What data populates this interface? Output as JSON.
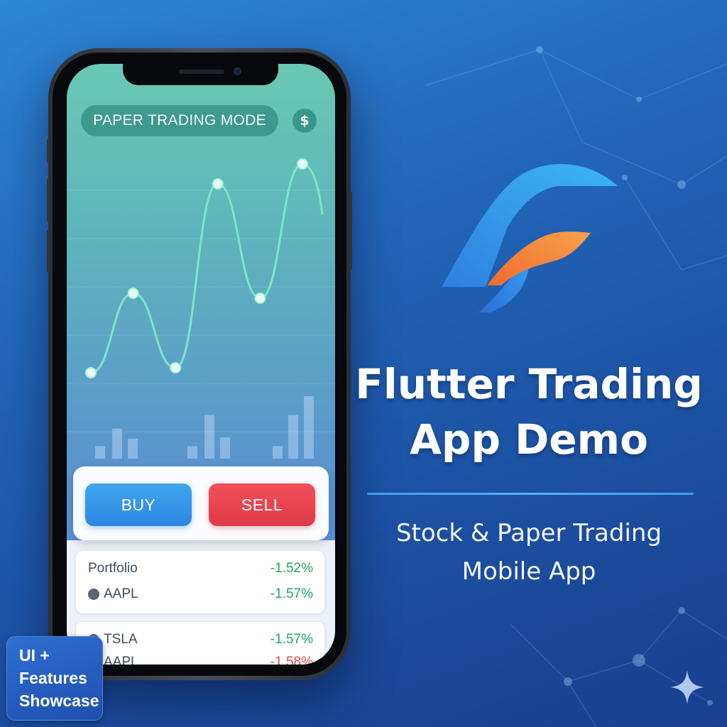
{
  "phone_app": {
    "mode_pill": "PAPER TRADING MODE",
    "dollar_icon": "$",
    "chart_data": {
      "type": "line",
      "series": [
        {
          "values": [
            0.1,
            0.42,
            0.12,
            0.86,
            0.4,
            0.94
          ]
        }
      ],
      "volume_bars": [
        1,
        2.4,
        1.6,
        1,
        3.5,
        1.7,
        1,
        3.5,
        5
      ]
    },
    "trade": {
      "buy_label": "BUY",
      "sell_label": "SELL"
    },
    "portfolio": {
      "header_label": "Portfolio",
      "header_change": "-1.52%",
      "items": [
        {
          "symbol": "AAPL",
          "change": "-1.57%"
        },
        {
          "symbol": "TSLA",
          "change": "-1.57%"
        },
        {
          "symbol": "AAPL",
          "change": "-1.58%"
        }
      ]
    }
  },
  "branding": {
    "title_line1": "Flutter Trading",
    "title_line2": "App Demo",
    "subtitle_line1": "Stock & Paper Trading",
    "subtitle_line2": "Mobile App",
    "badge_lines": [
      "UI +",
      "Features",
      "Showcase"
    ]
  },
  "colors": {
    "buy": "#2d86e0",
    "sell": "#de3a47",
    "positive": "#21a55b",
    "negative": "#e04848",
    "logo_blue": "#3a9cf0",
    "logo_orange": "#f2843a"
  },
  "icons": {
    "logo": "flutter-f-logo-icon",
    "sparkle": "sparkle-icon"
  }
}
